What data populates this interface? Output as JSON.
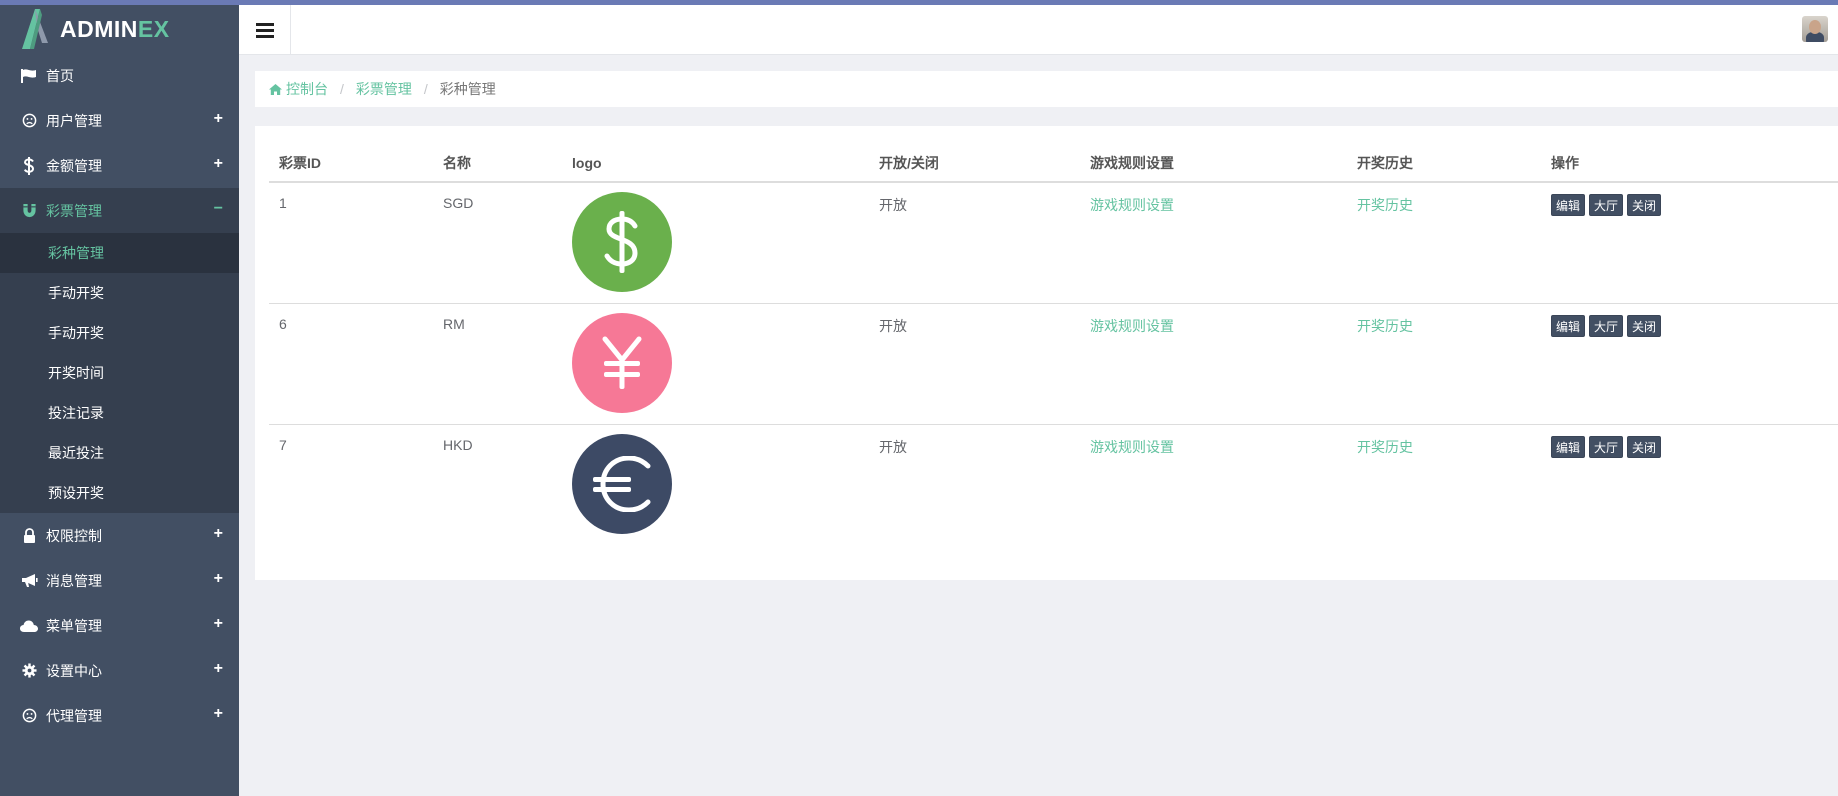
{
  "brand": {
    "part1": "ADMIN",
    "part2": "EX"
  },
  "sidebar": {
    "items": [
      {
        "label": "首页",
        "icon": "flag-icon",
        "expandable": false
      },
      {
        "label": "用户管理",
        "icon": "frown-icon",
        "expandable": true,
        "toggle": "+"
      },
      {
        "label": "金额管理",
        "icon": "dollar-icon",
        "expandable": true,
        "toggle": "+"
      },
      {
        "label": "彩票管理",
        "icon": "magnet-icon",
        "expandable": true,
        "toggle": "−",
        "active": true
      },
      {
        "label": "权限控制",
        "icon": "lock-icon",
        "expandable": true,
        "toggle": "+"
      },
      {
        "label": "消息管理",
        "icon": "bullhorn-icon",
        "expandable": true,
        "toggle": "+"
      },
      {
        "label": "菜单管理",
        "icon": "cloud-icon",
        "expandable": true,
        "toggle": "+"
      },
      {
        "label": "设置中心",
        "icon": "gear-icon",
        "expandable": true,
        "toggle": "+"
      },
      {
        "label": "代理管理",
        "icon": "frown-icon",
        "expandable": true,
        "toggle": "+"
      }
    ],
    "submenu": [
      {
        "label": "彩种管理",
        "active": true
      },
      {
        "label": "手动开奖"
      },
      {
        "label": "手动开奖"
      },
      {
        "label": "开奖时间"
      },
      {
        "label": "投注记录"
      },
      {
        "label": "最近投注"
      },
      {
        "label": "预设开奖"
      }
    ]
  },
  "breadcrumb": {
    "home": "控制台",
    "section": "彩票管理",
    "current": "彩种管理"
  },
  "table": {
    "headers": [
      "彩票ID",
      "名称",
      "logo",
      "开放/关闭",
      "游戏规则设置",
      "开奖历史",
      "操作"
    ],
    "rows": [
      {
        "id": "1",
        "name": "SGD",
        "logo_icon": "dollar-coin-icon",
        "logo_color": "#6ab04c",
        "status": "开放",
        "rules": "游戏规则设置",
        "history": "开奖历史"
      },
      {
        "id": "6",
        "name": "RM",
        "logo_icon": "yen-coin-icon",
        "logo_color": "#f67896",
        "status": "开放",
        "rules": "游戏规则设置",
        "history": "开奖历史"
      },
      {
        "id": "7",
        "name": "HKD",
        "logo_icon": "euro-coin-icon",
        "logo_color": "#3d4a65",
        "status": "开放",
        "rules": "游戏规则设置",
        "history": "开奖历史"
      }
    ],
    "actions": [
      "编辑",
      "大厅",
      "关闭"
    ]
  },
  "colors": {
    "sidebar": "#424f63",
    "accent": "#65c3a1",
    "topline": "#6a7ab5",
    "background": "#eff0f4"
  }
}
